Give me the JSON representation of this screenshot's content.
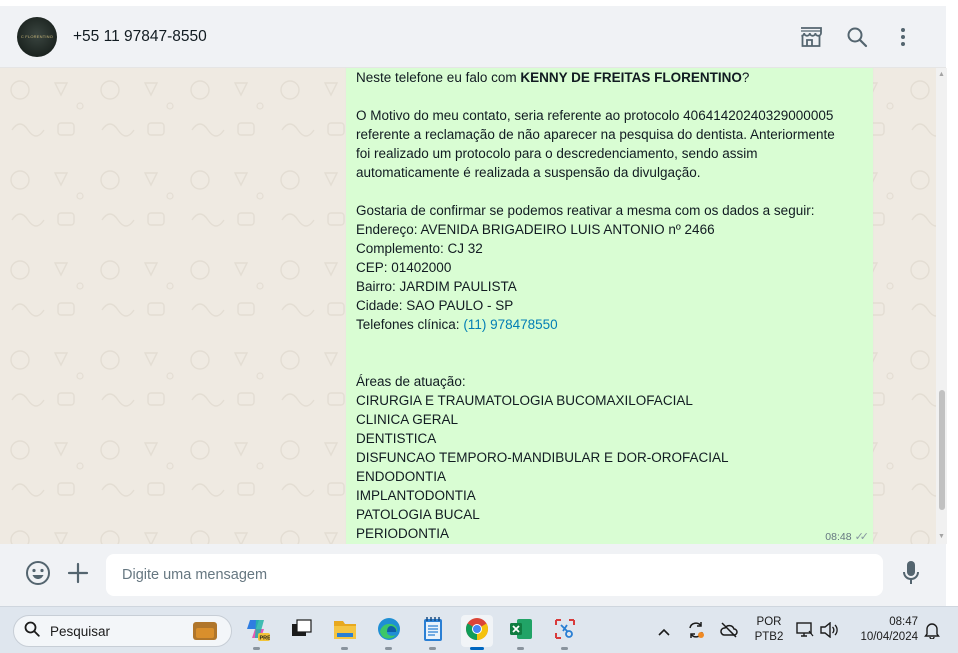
{
  "header": {
    "avatar_text": "C FLORENTINO",
    "contact_name": "+55 11 97847-8550",
    "actions": [
      "store-icon",
      "search-icon",
      "menu-icon"
    ]
  },
  "message": {
    "lines": [
      {
        "type": "mixed",
        "pre": "Neste telefone eu falo com ",
        "bold": "KENNY DE FREITAS FLORENTINO",
        "post": "?"
      },
      {
        "type": "blank"
      },
      {
        "type": "text",
        "text": "O Motivo do meu contato, seria referente ao protocolo 40641420240329000005"
      },
      {
        "type": "text",
        "text": "referente a reclamação de não aparecer na pesquisa do dentista. Anteriormente"
      },
      {
        "type": "text",
        "text": "foi realizado um protocolo para o descredenciamento, sendo assim"
      },
      {
        "type": "text",
        "text": "automaticamente é realizada a suspensão da divulgação."
      },
      {
        "type": "blank"
      },
      {
        "type": "text",
        "text": "Gostaria de confirmar se podemos reativar a mesma com os dados a seguir:"
      },
      {
        "type": "text",
        "text": "Endereço: AVENIDA BRIGADEIRO LUIS ANTONIO nº 2466"
      },
      {
        "type": "text",
        "text": "Complemento: CJ 32"
      },
      {
        "type": "text",
        "text": "CEP: 01402000"
      },
      {
        "type": "text",
        "text": "Bairro: JARDIM PAULISTA"
      },
      {
        "type": "text",
        "text": "Cidade: SAO PAULO - SP"
      },
      {
        "type": "link",
        "pre": "Telefones clínica: ",
        "link": "(11) 978478550"
      },
      {
        "type": "blank"
      },
      {
        "type": "blank"
      },
      {
        "type": "text",
        "text": "Áreas de atuação:"
      },
      {
        "type": "text",
        "text": "CIRURGIA E TRAUMATOLOGIA BUCOMAXILOFACIAL"
      },
      {
        "type": "text",
        "text": "CLINICA GERAL"
      },
      {
        "type": "text",
        "text": "DENTISTICA"
      },
      {
        "type": "text",
        "text": "DISFUNCAO TEMPORO-MANDIBULAR E DOR-OROFACIAL"
      },
      {
        "type": "text",
        "text": "ENDODONTIA"
      },
      {
        "type": "text",
        "text": "IMPLANTODONTIA"
      },
      {
        "type": "text",
        "text": "PATOLOGIA BUCAL"
      },
      {
        "type": "text",
        "text": "PERIODONTIA"
      }
    ],
    "time": "08:48",
    "status_icon": "double-check-icon"
  },
  "composer": {
    "placeholder": "Digite uma mensagem",
    "value": ""
  },
  "taskbar": {
    "search_label": "Pesquisar",
    "apps": [
      "copilot-icon",
      "task-view-icon",
      "file-explorer-icon",
      "edge-icon",
      "notepad-icon",
      "chrome-icon",
      "excel-icon",
      "snipping-tool-icon"
    ],
    "active_app": "chrome-icon",
    "lang_line1": "POR",
    "lang_line2": "PTB2",
    "time": "08:47",
    "date": "10/04/2024"
  }
}
